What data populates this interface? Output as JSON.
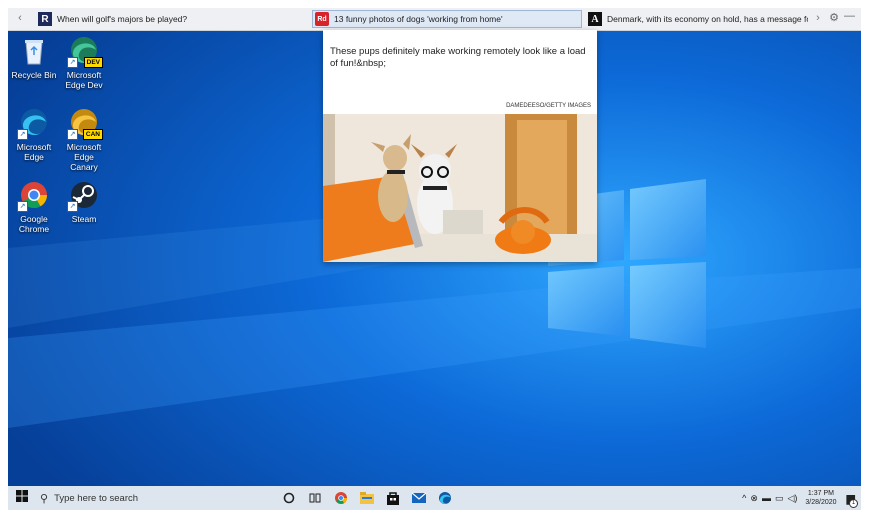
{
  "newsbar": {
    "back_icon": "chevron-left-icon",
    "items": [
      {
        "logo": "R",
        "title": "When will golf's majors be played?"
      },
      {
        "logo": "Rd",
        "title": "13 funny photos of dogs 'working from home'"
      },
      {
        "logo": "A",
        "title": "Denmark, with its economy on hold, has a message for..."
      }
    ],
    "forward_icon": "chevron-right-icon",
    "settings_icon": "gear-icon",
    "minimize_icon": "minimize-icon"
  },
  "desktop": {
    "icons": [
      {
        "label": "Recycle Bin",
        "icon": "recycle-bin-icon"
      },
      {
        "label": "Microsoft Edge Dev",
        "icon": "edge-dev-icon",
        "tag": "DEV"
      },
      {
        "label": "Microsoft Edge",
        "icon": "edge-icon"
      },
      {
        "label": "Microsoft Edge Canary",
        "icon": "edge-canary-icon",
        "tag": "CAN"
      },
      {
        "label": "Google Chrome",
        "icon": "chrome-icon"
      },
      {
        "label": "Steam",
        "icon": "steam-icon"
      }
    ]
  },
  "popup": {
    "text": "These pups definitely make working remotely look like a load of fun!&nbsp;",
    "credit": "DAMEDEESO/GETTY IMAGES",
    "photo_icon": "dogs-working-photo"
  },
  "taskbar": {
    "search_placeholder": "Type here to search",
    "pinned": [
      "cortana-icon",
      "task-view-icon",
      "chrome-icon",
      "file-explorer-icon",
      "store-icon",
      "mail-icon",
      "edge-icon"
    ],
    "tray_icons": [
      "chevron-up-icon",
      "link-icon",
      "battery-icon",
      "network-icon",
      "volume-icon"
    ],
    "time": "1:37 PM",
    "date": "3/28/2020",
    "notifications_badge": "1"
  },
  "colors": {
    "wallpaper": "#0b5fc4",
    "taskbar": "#dde6ee",
    "newsbar": "#eef0f3",
    "edge_dev_tag": "#ffd800"
  }
}
